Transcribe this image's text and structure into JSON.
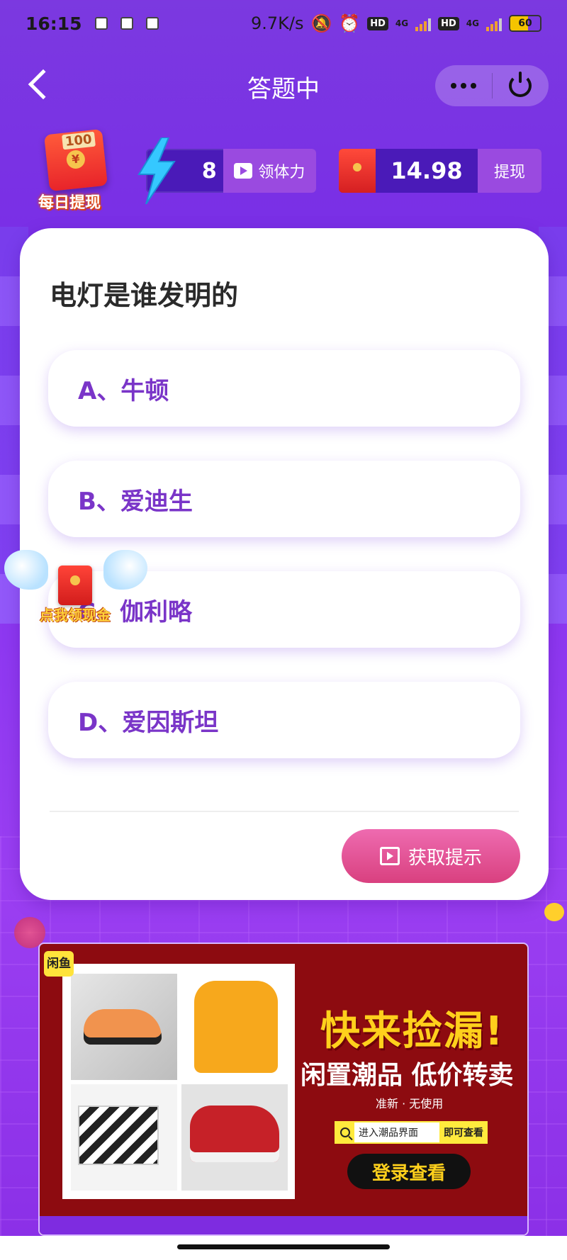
{
  "status_bar": {
    "time": "16:15",
    "net_speed": "9.7K/s",
    "hd1": "HD",
    "net1": "4G",
    "hd2": "HD",
    "net2": "4G",
    "battery": "60",
    "battery_level": 0.6
  },
  "nav": {
    "title": "答题中",
    "back_icon": "chevron-left-icon",
    "more_icon": "more-dots-icon",
    "power_icon": "power-icon"
  },
  "stats": {
    "daily_withdraw_amount": "100",
    "daily_withdraw_label": "每日提现",
    "energy_count": "8",
    "get_energy_label": "领体力",
    "balance": "14.98",
    "withdraw_label": "提现"
  },
  "quiz": {
    "question": "电灯是谁发明的",
    "options": [
      {
        "label": "A、牛顿"
      },
      {
        "label": "B、爱迪生"
      },
      {
        "label": "C、伽利略"
      },
      {
        "label": "D、爱因斯坦"
      }
    ],
    "hint_label": "获取提示"
  },
  "floating_packet": {
    "label": "点我领现金"
  },
  "ad": {
    "logo": "闲鱼",
    "headline": "快来捡漏!",
    "subtitle": "闲置潮品 低价转卖",
    "small": "准新 · 无使用",
    "search_text": "进入潮品界面",
    "search_go": "即可查看",
    "cta": "登录查看"
  },
  "colors": {
    "background": "#8a36f0",
    "option_text": "#7a35c8",
    "hint_button": "#e0508f",
    "stat_panel": "#4a1ab8"
  }
}
